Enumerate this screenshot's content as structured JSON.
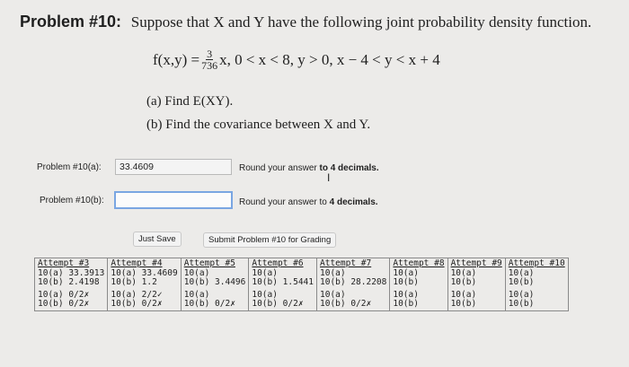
{
  "problem": {
    "number_label": "Problem #10:",
    "statement": "Suppose that X and Y have the following joint probability density function.",
    "formula_lhs": "f(x,y) =",
    "frac_num": "3",
    "frac_den": "736",
    "formula_rest": "x,  0 < x < 8, y > 0, x − 4 < y < x + 4",
    "part_a": "(a) Find E(XY).",
    "part_b": "(b) Find the covariance between X and Y."
  },
  "answers": {
    "a_label": "Problem #10(a):",
    "a_value": "33.4609",
    "a_note_prefix": "Round your answer ",
    "a_note_bold": "to 4 decimals.",
    "b_label": "Problem #10(b):",
    "b_value": "",
    "b_note_prefix": "Round your answer to ",
    "b_note_bold": "4 decimals."
  },
  "buttons": {
    "just_save": "Just Save",
    "submit": "Submit Problem #10 for Grading"
  },
  "attempts": [
    {
      "header": "Attempt #3",
      "lines": [
        "10(a) 33.3913",
        "10(b) 2.4198",
        "10(a) 0/2✗",
        "10(b) 0/2✗"
      ]
    },
    {
      "header": "Attempt #4",
      "lines": [
        "10(a) 33.4609",
        "10(b) 1.2",
        "10(a) 2/2✓",
        "10(b) 0/2✗"
      ]
    },
    {
      "header": "Attempt #5",
      "lines": [
        "10(a)",
        "10(b) 3.4496",
        "10(a)",
        "10(b) 0/2✗"
      ]
    },
    {
      "header": "Attempt #6",
      "lines": [
        "",
        "10(a)",
        "10(b) 1.5441",
        "10(a)",
        "10(b) 0/2✗"
      ]
    },
    {
      "header": "Attempt #7",
      "lines": [
        "10(a)",
        "10(b) 28.2208",
        "10(a)",
        "10(b) 0/2✗"
      ]
    },
    {
      "header": "Attempt #8",
      "lines": [
        "10(a)",
        "10(b)",
        "10(a)",
        "10(b)"
      ]
    },
    {
      "header": "Attempt #9",
      "lines": [
        "10(a)",
        "10(b)",
        "10(a)",
        "10(b)"
      ]
    },
    {
      "header": "Attempt #10",
      "lines": [
        "10(a)",
        "10(b)",
        "10(a)",
        "10(b)"
      ]
    }
  ]
}
